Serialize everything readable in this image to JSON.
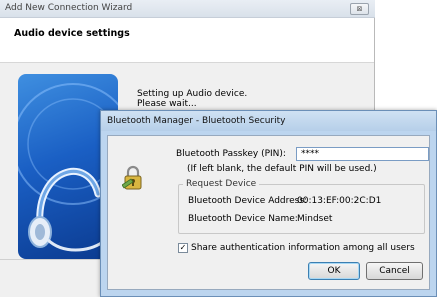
{
  "wizard": {
    "title": "Add New Connection Wizard",
    "close_glyph": "⊠",
    "heading": "Audio device settings",
    "status_line1": "Setting up Audio device.",
    "status_line2": "Please wait..."
  },
  "dialog": {
    "title": "Bluetooth Manager - Bluetooth Security",
    "passkey_label": "Bluetooth Passkey (PIN):",
    "passkey_value": "****",
    "passkey_hint": "(If left blank, the default PIN will be used.)",
    "group_title": "Request Device",
    "address_label": "Bluetooth Device Address:",
    "address_value": "00:13:EF:00:2C:D1",
    "name_label": "Bluetooth Device Name:",
    "name_value": "Mindset",
    "share_label": "Share authentication information among all users",
    "share_checked": true,
    "check_glyph": "✓",
    "ok_label": "OK",
    "cancel_label": "Cancel"
  },
  "icons": [
    "close-icon",
    "headset-illustration",
    "lock-key-icon",
    "checkbox-check-icon"
  ]
}
